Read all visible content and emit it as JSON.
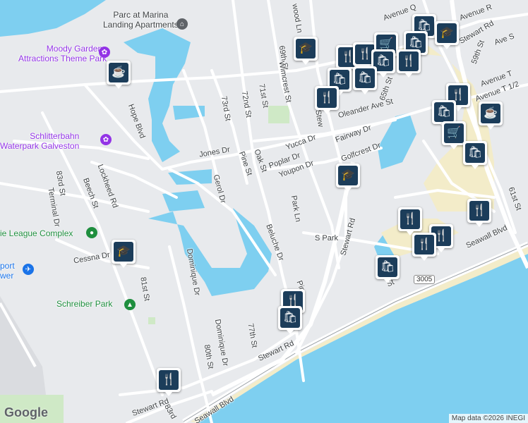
{
  "map": {
    "attribution": "Map data ©2026 INEGI",
    "logo": "Google",
    "poi_labels": [
      {
        "id": "parc_marina",
        "text": "Parc at Marina\nLanding Apartments"
      },
      {
        "id": "moody",
        "text": "Moody Gardens\nAttractions Theme Park"
      },
      {
        "id": "schlitter",
        "text": "Schlitterbahn\nWaterpark Galveston"
      },
      {
        "id": "league",
        "text": "ie League Complex"
      },
      {
        "id": "airport",
        "text": "port\nwer"
      },
      {
        "id": "schreiber",
        "text": "Schreiber Park"
      }
    ],
    "streets": [
      {
        "id": "avenue_q",
        "text": "Avenue Q"
      },
      {
        "id": "stewart_rd_top",
        "text": "Stewart Rd"
      },
      {
        "id": "ave_r",
        "text": "Avenue R"
      },
      {
        "id": "ave_s",
        "text": "Ave S"
      },
      {
        "id": "59th",
        "text": "59th St"
      },
      {
        "id": "avenue_t",
        "text": "Avenue T"
      },
      {
        "id": "avenue_t12",
        "text": "Avenue T 1/2"
      },
      {
        "id": "61st",
        "text": "61st St"
      },
      {
        "id": "69th",
        "text": "69th St"
      },
      {
        "id": "wimcrest",
        "text": "Wimcrest St"
      },
      {
        "id": "71st",
        "text": "71st St"
      },
      {
        "id": "72nd",
        "text": "72nd St"
      },
      {
        "id": "73rd",
        "text": "73rd St"
      },
      {
        "id": "lnwood",
        "text": "wood Ln"
      },
      {
        "id": "oleander",
        "text": "Oleander Ave St"
      },
      {
        "id": "65th",
        "text": "65th St"
      },
      {
        "id": "stew_mid",
        "text": "Stew"
      },
      {
        "id": "fairway",
        "text": "Fairway Dr"
      },
      {
        "id": "golfcrest",
        "text": "Golfcrest Dr"
      },
      {
        "id": "yucca",
        "text": "Yucca Dr"
      },
      {
        "id": "poplar",
        "text": "Poplar Dr"
      },
      {
        "id": "youpon",
        "text": "Youpon Dr"
      },
      {
        "id": "oak",
        "text": "Oak St"
      },
      {
        "id": "pine",
        "text": "Pine St"
      },
      {
        "id": "jones",
        "text": "Jones Dr"
      },
      {
        "id": "gerol",
        "text": "Gerol Dr"
      },
      {
        "id": "hope",
        "text": "Hope Blvd"
      },
      {
        "id": "lockheed",
        "text": "Lockheed Rd"
      },
      {
        "id": "beech",
        "text": "Beech St"
      },
      {
        "id": "83rd",
        "text": "83rd St"
      },
      {
        "id": "terminal",
        "text": "Terminal Dr"
      },
      {
        "id": "cessna",
        "text": "Cessna Dr"
      },
      {
        "id": "81st",
        "text": "81st St"
      },
      {
        "id": "dominique1",
        "text": "Dominique Dr"
      },
      {
        "id": "dominique2",
        "text": "Dominique Dr"
      },
      {
        "id": "80th",
        "text": "80th St"
      },
      {
        "id": "77th",
        "text": "77th St"
      },
      {
        "id": "park_ln",
        "text": "Park Ln"
      },
      {
        "id": "s_park",
        "text": "S Park"
      },
      {
        "id": "stewart_mid",
        "text": "Stewart Rd"
      },
      {
        "id": "beluche",
        "text": "Beluche Dr"
      },
      {
        "id": "pin_st",
        "text": "Pin"
      },
      {
        "id": "stewart_bot",
        "text": "Stewart Rd"
      },
      {
        "id": "stewart_bl",
        "text": "Stewart Rd"
      },
      {
        "id": "83rd_bot",
        "text": "83rd"
      },
      {
        "id": "seawall_bot",
        "text": "Seawall Blvd"
      },
      {
        "id": "seawall_right",
        "text": "Seawall Blvd"
      },
      {
        "id": "st_right",
        "text": "St"
      }
    ],
    "highway_shield": "3005",
    "pins": [
      {
        "type": "restaurant",
        "icon": "fork-knife-icon",
        "glyph": "🍴"
      },
      {
        "type": "coffee",
        "icon": "coffee-cup-icon",
        "glyph": "☕"
      },
      {
        "type": "school",
        "icon": "graduation-cap-icon",
        "glyph": "🎓"
      },
      {
        "type": "shopping",
        "icon": "shopping-bag-icon",
        "glyph": "🛍"
      },
      {
        "type": "grocery",
        "icon": "shopping-cart-icon",
        "glyph": "🛒"
      }
    ],
    "colors": {
      "water": "#7ecff0",
      "land": "#e8eaed",
      "park": "#cfe9c6",
      "beach": "#f3ecc9",
      "pin": "#1c3d5a"
    }
  }
}
